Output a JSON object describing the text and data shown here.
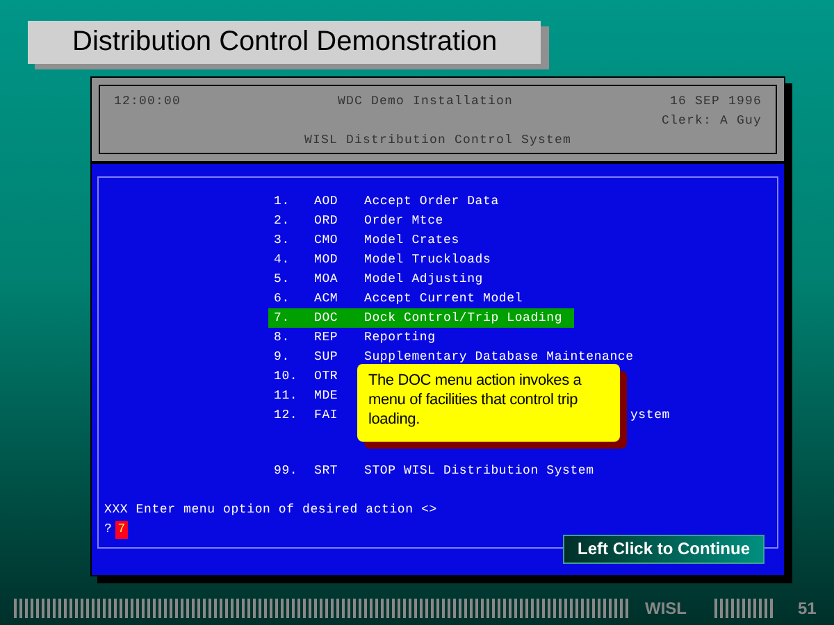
{
  "slide_title": "Distribution Control Demonstration",
  "terminal": {
    "header": {
      "time": "12:00:00",
      "installation": "WDC Demo Installation",
      "date": "16 SEP 1996",
      "clerk": "Clerk: A Guy",
      "system": "WISL Distribution Control System"
    },
    "menu": [
      {
        "number": "1.",
        "code": "AOD",
        "description": "Accept Order Data",
        "selected": false
      },
      {
        "number": "2.",
        "code": "ORD",
        "description": "Order Mtce",
        "selected": false
      },
      {
        "number": "3.",
        "code": "CMO",
        "description": "Model Crates",
        "selected": false
      },
      {
        "number": "4.",
        "code": "MOD",
        "description": "Model Truckloads",
        "selected": false
      },
      {
        "number": "5.",
        "code": "MOA",
        "description": "Model Adjusting",
        "selected": false
      },
      {
        "number": "6.",
        "code": "ACM",
        "description": "Accept Current Model",
        "selected": false
      },
      {
        "number": "7.",
        "code": "DOC",
        "description": "Dock Control/Trip Loading",
        "selected": true
      },
      {
        "number": "8.",
        "code": "REP",
        "description": "Reporting",
        "selected": false
      },
      {
        "number": "9.",
        "code": "SUP",
        "description": "Supplementary Database Maintenance",
        "selected": false
      },
      {
        "number": "10.",
        "code": "OTR",
        "selected": false
      },
      {
        "number": "11.",
        "code": "MDE",
        "selected": false
      },
      {
        "number": "12.",
        "code": "FAI",
        "description_tail": "ystem",
        "selected": false
      }
    ],
    "stop_item": {
      "number": "99.",
      "code": "SRT",
      "description": "STOP WISL Distribution System"
    },
    "prompt": "XXX Enter menu option of desired action <>",
    "input_prefix": "?",
    "input_value": "7"
  },
  "callout": "The DOC menu action invokes a menu of facilities that control trip loading.",
  "continue_button": "Left Click to Continue",
  "footer": {
    "brand": "WISL",
    "page": "51"
  }
}
